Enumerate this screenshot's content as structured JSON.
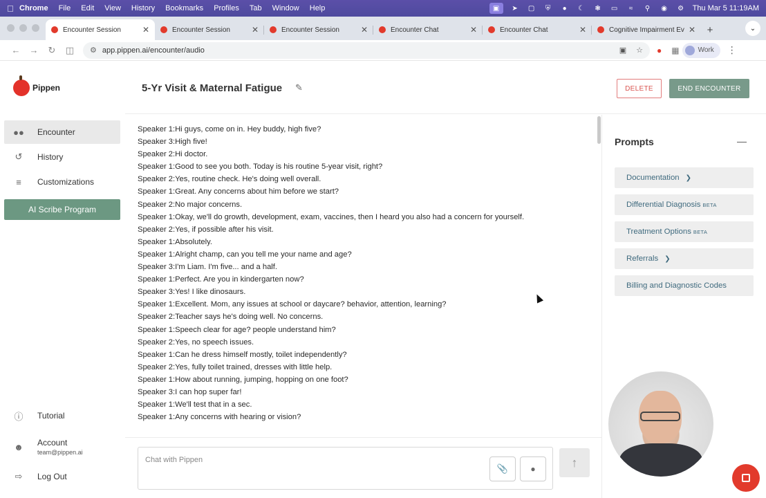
{
  "menubar": {
    "app": "Chrome",
    "items": [
      "File",
      "Edit",
      "View",
      "History",
      "Bookmarks",
      "Profiles",
      "Tab",
      "Window",
      "Help"
    ],
    "clock": "Thu Mar 5  11:19AM"
  },
  "tabs": [
    {
      "title": "Encounter Session",
      "active": true
    },
    {
      "title": "Encounter Session"
    },
    {
      "title": "Encounter Session"
    },
    {
      "title": "Encounter Chat"
    },
    {
      "title": "Encounter Chat"
    },
    {
      "title": "Cognitive Impairment Ev"
    }
  ],
  "toolbar": {
    "url": "app.pippen.ai/encounter/audio",
    "profile": "Work"
  },
  "sidebar": {
    "logo": "Pippen",
    "items": [
      {
        "label": "Encounter",
        "icon": "people-icon"
      },
      {
        "label": "History",
        "icon": "history-icon"
      },
      {
        "label": "Customizations",
        "icon": "sliders-icon"
      }
    ],
    "program_button": "AI Scribe Program",
    "tutorial": "Tutorial",
    "account": "Account",
    "account_email": "team@pippen.ai",
    "logout": "Log Out"
  },
  "header": {
    "title": "5-Yr Visit & Maternal Fatigue",
    "delete_label": "DELETE",
    "end_label": "END ENCOUNTER"
  },
  "transcript": [
    "Speaker 1:Hi guys, come on in. Hey buddy, high five?",
    "Speaker 3:High five!",
    "Speaker 2:Hi doctor.",
    "Speaker 1:Good to see you both. Today is his routine 5-year visit, right?",
    "Speaker 2:Yes, routine check. He's doing well overall.",
    "Speaker 1:Great. Any concerns about him before we start?",
    "Speaker 2:No major concerns.",
    "Speaker 1:Okay, we'll do growth, development, exam, vaccines, then I heard you also had a concern for yourself.",
    "Speaker 2:Yes, if possible after his visit.",
    "Speaker 1:Absolutely.",
    "Speaker 1:Alright champ, can you tell me your name and age?",
    "Speaker 3:I'm Liam. I'm five... and a half.",
    "Speaker 1:Perfect. Are you in kindergarten now?",
    "Speaker 3:Yes! I like dinosaurs.",
    "Speaker 1:Excellent. Mom, any issues at school or daycare? behavior, attention, learning?",
    "Speaker 2:Teacher says he's doing well. No concerns.",
    "Speaker 1:Speech clear for age? people understand him?",
    "Speaker 2:Yes, no speech issues.",
    "Speaker 1:Can he dress himself mostly, toilet independently?",
    "Speaker 2:Yes, fully toilet trained, dresses with little help.",
    "Speaker 1:How about running, jumping, hopping on one foot?",
    "Speaker 3:I can hop super far!",
    "Speaker 1:We'll test that in a sec.",
    "Speaker 1:Any concerns with hearing or vision?"
  ],
  "chat": {
    "placeholder": "Chat with Pippen"
  },
  "prompts": {
    "title": "Prompts",
    "items": [
      {
        "label": "Documentation",
        "chevron": true
      },
      {
        "label": "Differential Diagnosis",
        "badge": "BETA"
      },
      {
        "label": "Treatment Options",
        "badge": "BETA"
      },
      {
        "label": "Referrals",
        "chevron": true
      },
      {
        "label": "Billing and Diagnostic Codes"
      }
    ]
  },
  "colors": {
    "accent_green": "#6c9882",
    "danger": "#d9534f",
    "prompt_text": "#3f6a7e",
    "record": "#e23a2c"
  }
}
